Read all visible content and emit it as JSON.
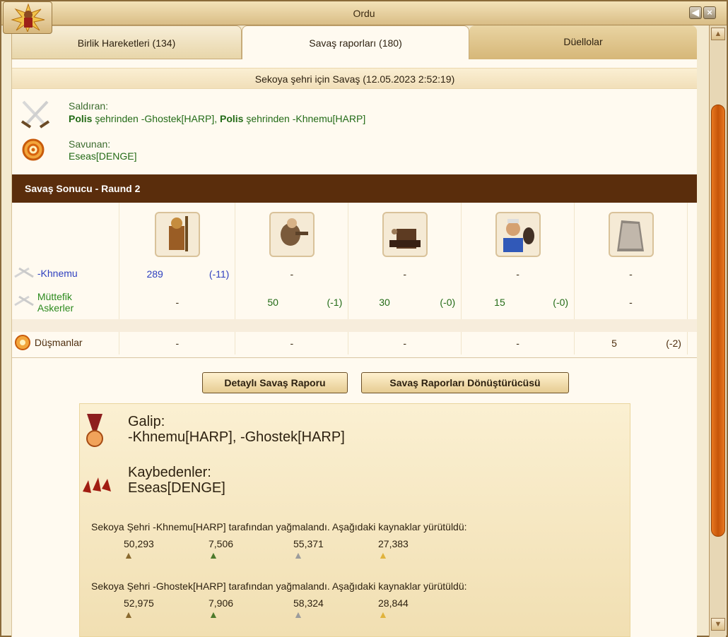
{
  "window": {
    "title": "Ordu"
  },
  "tabs": [
    {
      "label": "Birlik Hareketleri (134)"
    },
    {
      "label": "Savaş raporları (180)"
    },
    {
      "label": "Düellolar"
    }
  ],
  "report": {
    "title": "Sekoya şehri için Savaş (12.05.2023 2:52:19)",
    "attacker_label": "Saldıran:",
    "attacker_1_city": "Polis",
    "attacker_1_rest": " şehrinden -Ghostek[HARP], ",
    "attacker_2_city": "Polis",
    "attacker_2_rest": " şehrinden -Khnemu[HARP]",
    "defender_label": "Savunan:",
    "defender": "Eseas[DENGE]"
  },
  "round_bar": "Savaş Sonucu - Raund 2",
  "rows": {
    "khnemu": {
      "name": "-Khnemu",
      "c1": "289",
      "c1_loss": "(-11)",
      "c2": "-",
      "c3": "-",
      "c4": "-",
      "c5": "-"
    },
    "allies": {
      "name_1": "Müttefik",
      "name_2": "Askerler",
      "c1": "-",
      "c2": "50",
      "c2_loss": "(-1)",
      "c3": "30",
      "c3_loss": "(-0)",
      "c4": "15",
      "c4_loss": "(-0)",
      "c5": "-"
    },
    "enemies": {
      "name": "Düşmanlar",
      "c1": "-",
      "c2": "-",
      "c3": "-",
      "c4": "-",
      "c5": "5",
      "c5_loss": "(-2)"
    }
  },
  "buttons": {
    "detailed": "Detaylı Savaş Raporu",
    "converter": "Savaş Raporları Dönüştürücüsü"
  },
  "result": {
    "winner_label": "Galip:",
    "winners": "-Khnemu[HARP], -Ghostek[HARP]",
    "loser_label": "Kaybedenler:",
    "losers": "Eseas[DENGE]",
    "loot_1_text": "Sekoya Şehri -Khnemu[HARP] tarafından yağmalandı. Aşağıdaki kaynaklar yürütüldü:",
    "loot_1": [
      "50,293",
      "7,506",
      "55,371",
      "27,383"
    ],
    "loot_2_text": "Sekoya Şehri -Ghostek[HARP] tarafından yağmalandı. Aşağıdaki kaynaklar yürütüldü:",
    "loot_2": [
      "52,975",
      "7,906",
      "58,324",
      "28,844"
    ]
  },
  "icons": [
    "army-icon",
    "crossed-swords-icon",
    "shield-target-icon",
    "medal-icon",
    "fallen-soldiers-icon",
    "wood-icon",
    "stone-icon",
    "iron-icon",
    "gold-icon"
  ]
}
